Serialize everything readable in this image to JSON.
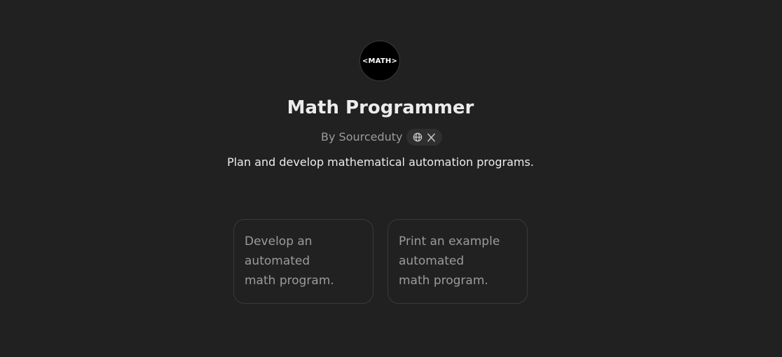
{
  "gpt": {
    "avatar_text": "<MATH>",
    "name": "Math Programmer",
    "byline": "By Sourceduty",
    "description": "Plan and develop mathematical automation programs.",
    "social_icons": [
      "globe-icon",
      "x-logo-icon"
    ]
  },
  "conversation_starters": [
    {
      "text": "Develop an\nautomated\nmath program."
    },
    {
      "text": "Print an example\nautomated\nmath program."
    }
  ],
  "colors": {
    "background": "#212121",
    "title": "#ececec",
    "muted_text": "#9b9b9b",
    "card_border": "#3a3a3a",
    "pill_background": "#2f2f2f"
  }
}
